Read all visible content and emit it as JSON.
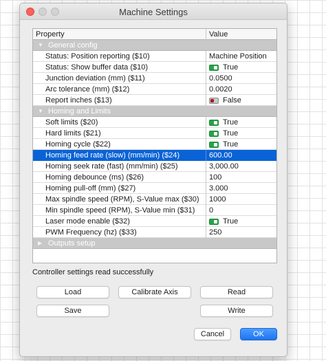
{
  "window": {
    "title": "Machine Settings"
  },
  "table": {
    "col_property": "Property",
    "col_value": "Value",
    "rows": [
      {
        "kind": "group",
        "label": "General config",
        "arrow": "▼"
      },
      {
        "kind": "item",
        "label": "Status: Position reporting ($10)",
        "value": "Machine Position"
      },
      {
        "kind": "item",
        "label": "Status: Show buffer data ($10)",
        "value": "True",
        "toggle": "on"
      },
      {
        "kind": "item",
        "label": "Junction deviation (mm) ($11)",
        "value": "0.0500"
      },
      {
        "kind": "item",
        "label": "Arc tolerance (mm) ($12)",
        "value": "0.0020"
      },
      {
        "kind": "item",
        "label": "Report inches ($13)",
        "value": "False",
        "toggle": "off"
      },
      {
        "kind": "group",
        "label": "Homing and Limits",
        "arrow": "▼"
      },
      {
        "kind": "item",
        "label": "Soft limits ($20)",
        "value": "True",
        "toggle": "on"
      },
      {
        "kind": "item",
        "label": "Hard limits ($21)",
        "value": "True",
        "toggle": "on"
      },
      {
        "kind": "item",
        "label": "Homing cycle ($22)",
        "value": "True",
        "toggle": "on"
      },
      {
        "kind": "item",
        "label": "Homing feed rate (slow) (mm/min) ($24)",
        "value": "600.00",
        "selected": true
      },
      {
        "kind": "item",
        "label": "Homing seek rate (fast) (mm/min) ($25)",
        "value": "3,000.00"
      },
      {
        "kind": "item",
        "label": "Homing debounce (ms) ($26)",
        "value": "100"
      },
      {
        "kind": "item",
        "label": "Homing pull-off (mm) ($27)",
        "value": "3.000"
      },
      {
        "kind": "item",
        "label": "Max spindle speed (RPM), S-Value max ($30)",
        "value": "1000"
      },
      {
        "kind": "item",
        "label": "Min spindle speed (RPM), S-Value min ($31)",
        "value": "0"
      },
      {
        "kind": "item",
        "label": "Laser mode enable ($32)",
        "value": "True",
        "toggle": "on"
      },
      {
        "kind": "item",
        "label": "PWM Frequency (hz) ($33)",
        "value": "250"
      },
      {
        "kind": "group",
        "label": "Outputs setup",
        "arrow": "▶"
      }
    ]
  },
  "status_text": "Controller settings read successfully",
  "buttons": {
    "load": "Load",
    "calibrate": "Calibrate Axis",
    "read": "Read",
    "save": "Save",
    "write": "Write",
    "cancel": "Cancel",
    "ok": "OK"
  },
  "colors": {
    "selection": "#0a63d6",
    "toggle_on": "#27a349",
    "ok_button": "#1f74f0"
  }
}
